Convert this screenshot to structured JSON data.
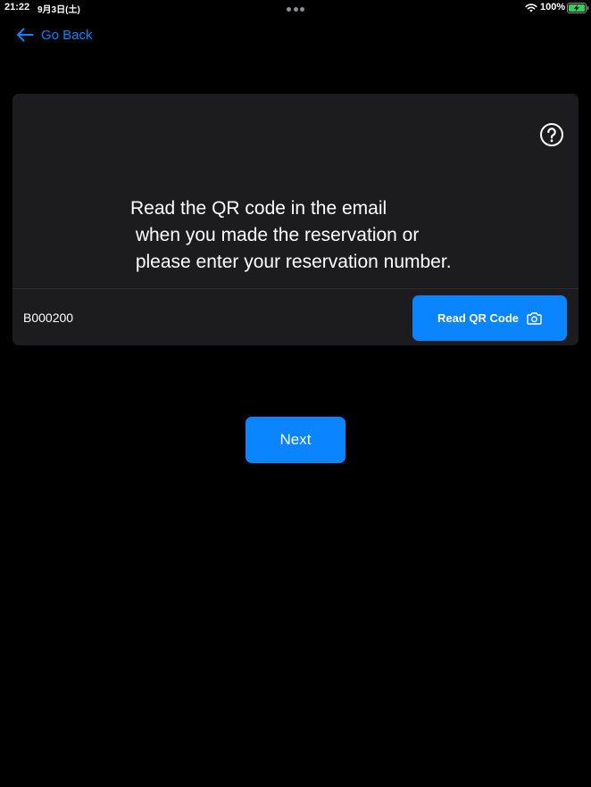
{
  "status_bar": {
    "time": "21:22",
    "date": "9月3日(土)",
    "battery": "100%",
    "icons": [
      "multitask-dots-icon",
      "wifi-icon",
      "battery-charging-icon"
    ]
  },
  "nav": {
    "back_label": "Go Back",
    "back_icon": "arrow-left-icon"
  },
  "card": {
    "help_icon": "question-circle-icon",
    "instruction": "Read the QR code in the email\n when you made the reservation or\n please enter your reservation number.",
    "reservation_value": "B000200",
    "read_qr_label": "Read QR Code",
    "read_qr_icon": "camera-icon"
  },
  "actions": {
    "next_label": "Next"
  },
  "colors": {
    "background": "#000000",
    "card": "#1c1c1e",
    "accent": "#0a84ff",
    "text": "#ffffff"
  }
}
